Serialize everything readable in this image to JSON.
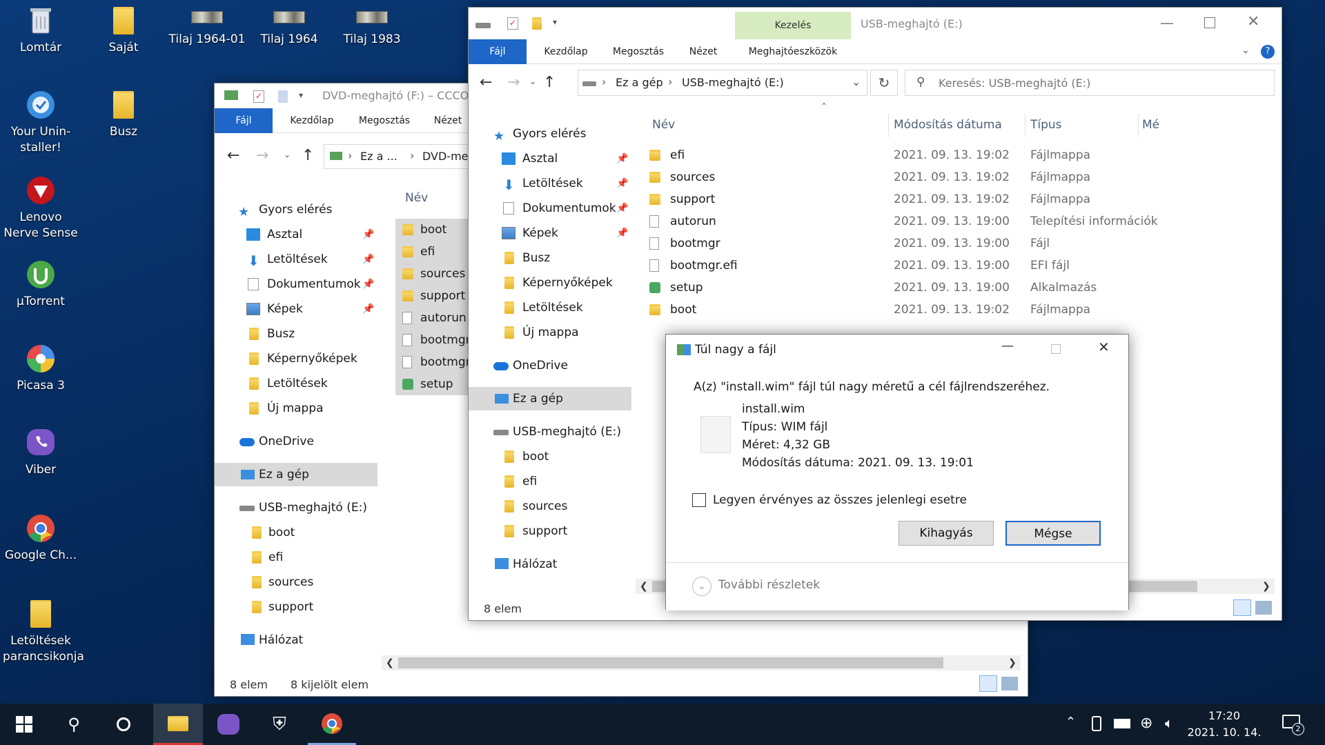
{
  "desktop": {
    "icons": [
      {
        "label": "Lomtár",
        "icon": "recycle-bin-icon"
      },
      {
        "label": "Saját",
        "icon": "user-folder-icon"
      },
      {
        "label": "Tilaj 1964-01",
        "icon": "image-thumbnail-icon"
      },
      {
        "label": "Tilaj 1964",
        "icon": "image-thumbnail-icon"
      },
      {
        "label": "Tilaj 1983",
        "icon": "image-thumbnail-icon"
      },
      {
        "label": "Your Unin-staller!",
        "icon": "uninstaller-icon"
      },
      {
        "label": "Busz",
        "icon": "folder-icon"
      },
      {
        "label": "Lenovo Nerve Sense",
        "icon": "lenovo-nerve-sense-icon"
      },
      {
        "label": "µTorrent",
        "icon": "utorrent-icon"
      },
      {
        "label": "Picasa 3",
        "icon": "picasa-icon"
      },
      {
        "label": "Viber",
        "icon": "viber-icon"
      },
      {
        "label": "Google Ch...",
        "icon": "chrome-icon"
      },
      {
        "label": "Letöltések parancsikonja",
        "icon": "downloads-shortcut-icon"
      }
    ]
  },
  "back_window": {
    "title": "DVD-meghajtó (F:) – CCCO",
    "tabs": {
      "file": "Fájl",
      "home": "Kezdőlap",
      "share": "Megosztás",
      "view": "Nézet"
    },
    "breadcrumb": {
      "a": "Ez a ...",
      "b": "DVD-me"
    },
    "nav": {
      "quick": "Gyors elérés",
      "desktop": "Asztal",
      "downloads": "Letöltések",
      "documents": "Dokumentumok",
      "pictures": "Képek",
      "busz": "Busz",
      "screenshots": "Képernyőképek",
      "downloads2": "Letöltések",
      "newfolder": "Új mappa",
      "onedrive": "OneDrive",
      "thispc": "Ez a gép",
      "usb": "USB-meghajtó (E:)",
      "boot": "boot",
      "efi": "efi",
      "sources": "sources",
      "support": "support",
      "network": "Hálózat"
    },
    "col_name": "Név",
    "files": [
      "boot",
      "efi",
      "sources",
      "support",
      "autorun",
      "bootmgr",
      "bootmgr",
      "setup"
    ],
    "status_count": "8 elem",
    "status_selected": "8 kijelölt elem"
  },
  "front_window": {
    "title": "USB-meghajtó (E:)",
    "context_tab": "Kezelés",
    "tabs": {
      "file": "Fájl",
      "home": "Kezdőlap",
      "share": "Megosztás",
      "view": "Nézet",
      "drivetools": "Meghajtóeszközök"
    },
    "breadcrumb": {
      "a": "Ez a gép",
      "b": "USB-meghajtó (E:)"
    },
    "search_placeholder": "Keresés: USB-meghajtó (E:)",
    "nav": {
      "quick": "Gyors elérés",
      "desktop": "Asztal",
      "downloads": "Letöltések",
      "documents": "Dokumentumok",
      "pictures": "Képek",
      "busz": "Busz",
      "screenshots": "Képernyőképek",
      "downloads2": "Letöltések",
      "newfolder": "Új mappa",
      "onedrive": "OneDrive",
      "thispc": "Ez a gép",
      "usb": "USB-meghajtó (E:)",
      "boot": "boot",
      "efi": "efi",
      "sources": "sources",
      "support": "support",
      "network": "Hálózat"
    },
    "columns": {
      "name": "Név",
      "modified": "Módosítás dátuma",
      "type": "Típus",
      "size": "Mé"
    },
    "files": [
      {
        "name": "efi",
        "date": "2021. 09. 13. 19:02",
        "type": "Fájlmappa"
      },
      {
        "name": "sources",
        "date": "2021. 09. 13. 19:02",
        "type": "Fájlmappa"
      },
      {
        "name": "support",
        "date": "2021. 09. 13. 19:02",
        "type": "Fájlmappa"
      },
      {
        "name": "autorun",
        "date": "2021. 09. 13. 19:00",
        "type": "Telepítési információk"
      },
      {
        "name": "bootmgr",
        "date": "2021. 09. 13. 19:00",
        "type": "Fájl"
      },
      {
        "name": "bootmgr.efi",
        "date": "2021. 09. 13. 19:00",
        "type": "EFI fájl"
      },
      {
        "name": "setup",
        "date": "2021. 09. 13. 19:00",
        "type": "Alkalmazás"
      },
      {
        "name": "boot",
        "date": "2021. 09. 13. 19:02",
        "type": "Fájlmappa"
      }
    ],
    "status_count": "8 elem"
  },
  "dialog": {
    "title": "Túl nagy a fájl",
    "message": "A(z) \"install.wim\" fájl túl nagy méretű a cél fájlrendszeréhez.",
    "file_name": "install.wim",
    "file_type": "Típus: WIM fájl",
    "file_size": "Méret: 4,32 GB",
    "file_modified": "Módosítás dátuma: 2021. 09. 13. 19:01",
    "checkbox_label": "Legyen érvényes az összes jelenlegi esetre",
    "skip_button": "Kihagyás",
    "cancel_button": "Mégse",
    "details": "További részletek"
  },
  "taskbar": {
    "time": "17:20",
    "date": "2021. 10. 14.",
    "notification_count": "2"
  },
  "colors": {
    "accent": "#1e66c8",
    "context_tab": "#d6ecc0",
    "taskbar": "#0e1b2b",
    "selection": "#d9d9d9"
  }
}
